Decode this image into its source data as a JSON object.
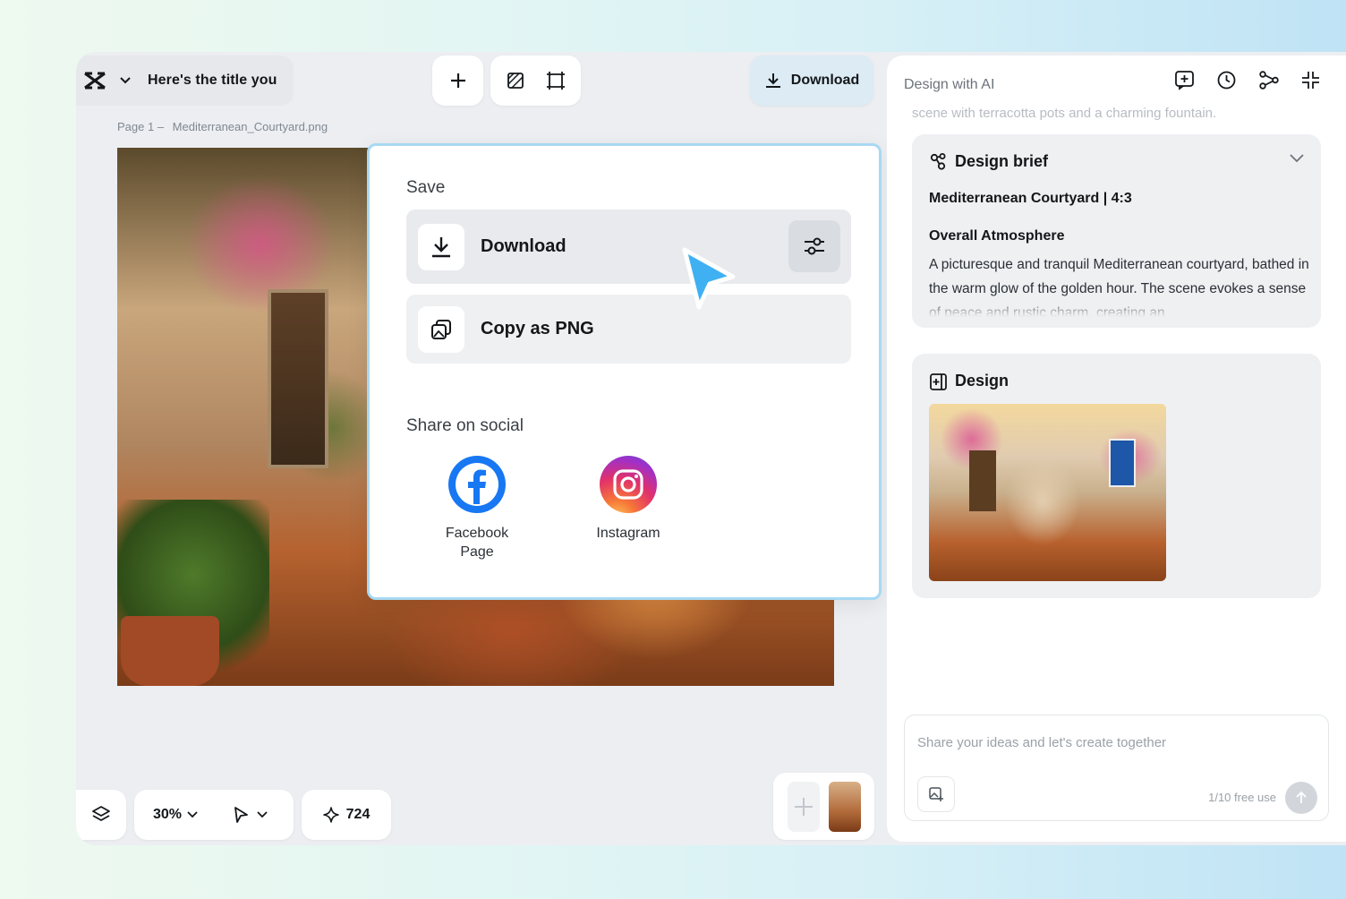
{
  "header": {
    "title": "Here's the title you",
    "download_label": "Download"
  },
  "canvas": {
    "page_label": "Page 1 –",
    "file_name": "Mediterranean_Courtyard.png"
  },
  "popup": {
    "save_title": "Save",
    "download_label": "Download",
    "copy_label": "Copy as PNG",
    "share_title": "Share on social",
    "social": [
      {
        "label": "Facebook Page",
        "icon": "facebook-icon",
        "color": "#1877f2"
      },
      {
        "label": "Instagram",
        "icon": "instagram-icon",
        "color": "#e1306c"
      }
    ]
  },
  "bottom_bar": {
    "zoom": "30%",
    "credits": "724"
  },
  "right_panel": {
    "title": "Design with AI",
    "faded_line": "scene with terracotta pots and a charming fountain.",
    "brief": {
      "title": "Design brief",
      "subtitle": "Mediterranean Courtyard | 4:3",
      "heading": "Overall Atmosphere",
      "text": "A picturesque and tranquil Mediterranean courtyard, bathed in the warm glow of the golden hour. The scene evokes a sense of peace and rustic charm, creating an"
    },
    "design": {
      "title": "Design"
    },
    "input": {
      "placeholder": "Share your ideas and let's create together",
      "free_use": "1/10 free use"
    }
  },
  "colors": {
    "accent": "#4fb3f0",
    "facebook": "#1877f2",
    "popup_border": "#a8d9f2"
  }
}
